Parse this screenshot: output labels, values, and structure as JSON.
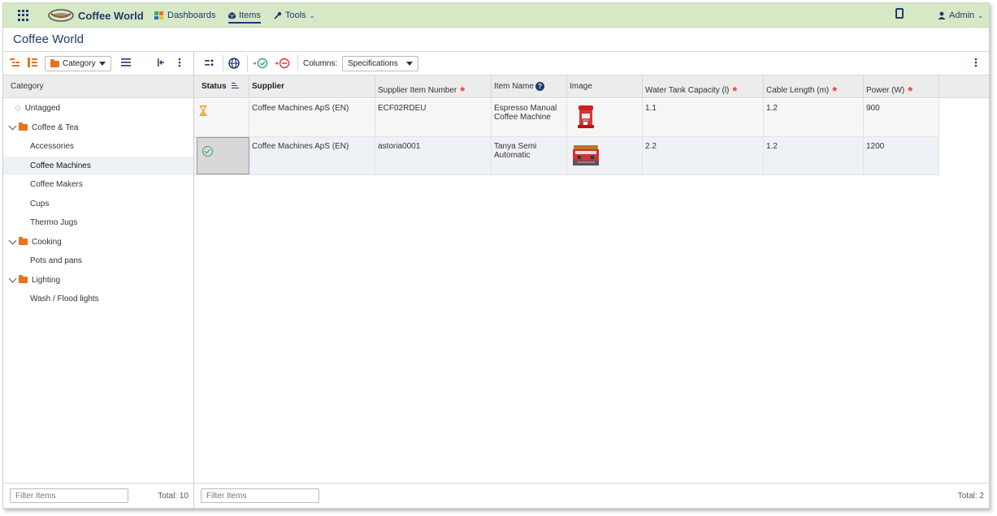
{
  "topbar": {
    "brand": "Coffee World",
    "nav": [
      {
        "label": "Dashboards",
        "active": false
      },
      {
        "label": "Items",
        "active": true
      },
      {
        "label": "Tools",
        "active": false
      }
    ],
    "user": "Admin"
  },
  "page": {
    "title": "Coffee World"
  },
  "left_toolbar": {
    "category_dropdown": "Category"
  },
  "right_toolbar": {
    "columns_label": "Columns:",
    "columns_value": "Specifications"
  },
  "tree": {
    "header": "Category",
    "nodes": [
      {
        "label": "Untagged",
        "level": 0,
        "type": "tag",
        "selected": false
      },
      {
        "label": "Coffee & Tea",
        "level": 0,
        "type": "folder",
        "selected": false
      },
      {
        "label": "Accessories",
        "level": 1,
        "type": "leaf",
        "selected": false
      },
      {
        "label": "Coffee Machines",
        "level": 1,
        "type": "leaf",
        "selected": true
      },
      {
        "label": "Coffee Makers",
        "level": 1,
        "type": "leaf",
        "selected": false
      },
      {
        "label": "Cups",
        "level": 1,
        "type": "leaf",
        "selected": false
      },
      {
        "label": "Thermo Jugs",
        "level": 1,
        "type": "leaf",
        "selected": false
      },
      {
        "label": "Cooking",
        "level": 0,
        "type": "folder",
        "selected": false
      },
      {
        "label": "Pots and pans",
        "level": 1,
        "type": "leaf",
        "selected": false
      },
      {
        "label": "Lighting",
        "level": 0,
        "type": "folder",
        "selected": false
      },
      {
        "label": "Wash / Flood lights",
        "level": 1,
        "type": "leaf",
        "selected": false
      }
    ]
  },
  "grid": {
    "columns": [
      {
        "label": "Status",
        "bold": true,
        "required": false
      },
      {
        "label": "Supplier",
        "bold": true,
        "required": false
      },
      {
        "label": "Supplier Item Number",
        "bold": false,
        "required": true
      },
      {
        "label": "Item Name",
        "bold": false,
        "required": false,
        "help": true
      },
      {
        "label": "Image",
        "bold": false,
        "required": false
      },
      {
        "label": "Water Tank Capacity (l)",
        "bold": false,
        "required": true
      },
      {
        "label": "Cable Length (m)",
        "bold": false,
        "required": true
      },
      {
        "label": "Power (W)",
        "bold": false,
        "required": true
      }
    ],
    "rows": [
      {
        "status": "pending",
        "supplier": "Coffee Machines ApS (EN)",
        "supplier_item_number": "ECF02RDEU",
        "item_name": "Espresso Manual Coffee Machine",
        "image": "espresso-machine-image",
        "water_tank_capacity": "1.1",
        "cable_length": "1.2",
        "power": "900"
      },
      {
        "status": "approved",
        "supplier": "Coffee Machines ApS (EN)",
        "supplier_item_number": "astoria0001",
        "item_name": "Tanya Semi Automatic",
        "image": "semi-automatic-machine-image",
        "water_tank_capacity": "2.2",
        "cable_length": "1.2",
        "power": "1200"
      }
    ]
  },
  "footer": {
    "left_filter_placeholder": "Filter Items",
    "left_total": "Total: 10",
    "right_filter_placeholder": "Filter Items",
    "right_total": "Total: 2"
  },
  "colors": {
    "topbar_bg": "#d6e8c6",
    "navy": "#1f3b6e",
    "folder_orange": "#e8731d",
    "required_red": "#e33333",
    "status_approved_green": "#3aa76d",
    "status_pending_orange": "#f0a020"
  },
  "icons": [
    "app-grid-icon",
    "coffee-world-logo",
    "dashboard-icon",
    "items-cube-icon",
    "tools-wrench-icon",
    "clipboard-icon",
    "user-icon",
    "tree-expand-icon",
    "tree-collapse-icon",
    "folder-icon",
    "list-icon",
    "collapse-panel-icon",
    "kebab-menu-icon",
    "globe-icon",
    "approve-icon",
    "reject-icon",
    "hourglass-icon",
    "check-circle-icon"
  ]
}
